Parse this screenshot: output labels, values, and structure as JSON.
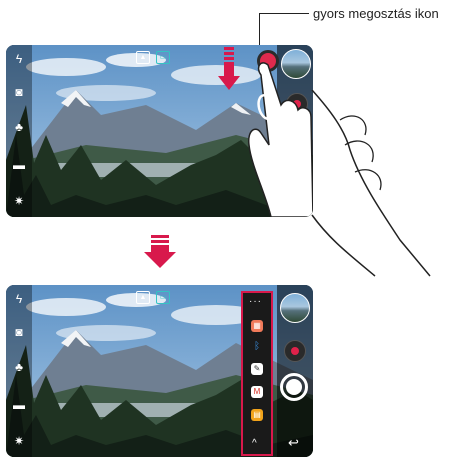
{
  "callout": {
    "label": "gyors megosztás ikon"
  },
  "screens": [
    {
      "id": "before"
    },
    {
      "id": "after"
    }
  ],
  "colors": {
    "accent_pink": "#d8194c",
    "record_red": "#e0224a",
    "status_teal": "#35c4c4"
  },
  "icons": {
    "left_bar": [
      "flash-off-icon",
      "camera-switch-icon",
      "filter-icon",
      "mode-bar-icon",
      "settings-icon"
    ],
    "top": [
      "hdr-icon",
      "ratio-icon"
    ],
    "share_panel": [
      "more-icon",
      "gallery-app-icon",
      "bluetooth-icon",
      "pen-app-icon",
      "gmail-icon",
      "memo-app-icon",
      "chevron-up-icon"
    ]
  }
}
